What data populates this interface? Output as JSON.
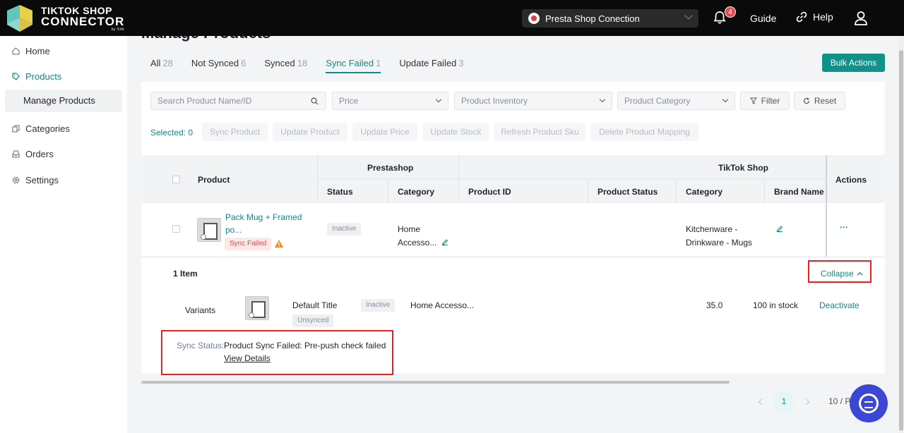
{
  "header": {
    "logo": {
      "line1": "TIKTOK SHOP",
      "line2": "CONNECTOR",
      "line3": "by Sitk"
    },
    "shop_select": "Presta Shop Conection",
    "notifications_count": "4",
    "guide": "Guide",
    "help": "Help"
  },
  "sidebar": {
    "items": [
      {
        "label": "Home",
        "icon": "home-icon"
      },
      {
        "label": "Products",
        "icon": "tag-icon"
      },
      {
        "label": "Manage Products"
      },
      {
        "label": "Categories",
        "icon": "copy-icon"
      },
      {
        "label": "Orders",
        "icon": "inbox-icon"
      },
      {
        "label": "Settings",
        "icon": "gear-icon"
      }
    ]
  },
  "page": {
    "title": "Manage Products"
  },
  "tabs": [
    {
      "label": "All",
      "count": "28"
    },
    {
      "label": "Not Synced",
      "count": "6"
    },
    {
      "label": "Synced",
      "count": "18"
    },
    {
      "label": "Sync Failed",
      "count": "1"
    },
    {
      "label": "Update Failed",
      "count": "3"
    }
  ],
  "bulk_actions": "Bulk Actions",
  "filters": {
    "search_placeholder": "Search Product Name/ID",
    "price": "Price",
    "inventory": "Product Inventory",
    "category": "Product Category",
    "filter": "Filter",
    "reset": "Reset"
  },
  "selection": {
    "selected": "Selected: 0",
    "actions": [
      "Sync Product",
      "Update Product",
      "Update Price",
      "Update Stock",
      "Refresh Product Sku",
      "Delete Product Mapping"
    ]
  },
  "table": {
    "group_prestashop": "Prestashop",
    "group_tiktok": "TikTok Shop",
    "col_product": "Product",
    "col_actions": "Actions",
    "cols": [
      "Status",
      "Category",
      "Product ID",
      "Product Status",
      "Category",
      "Brand Name"
    ],
    "row": {
      "name_line1": "Pack Mug + Framed",
      "name_line2": "po...",
      "sync_badge": "Sync Failed",
      "status": "Inactive",
      "category_line1": "Home",
      "category_line2": "Accesso...",
      "tiktok_category_line1": "Kitchenware -",
      "tiktok_category_line2": "Drinkware - Mugs",
      "more": "···"
    }
  },
  "expanded": {
    "items": "1 Item",
    "collapse": "Collapse",
    "variants_label": "Variants",
    "variant": {
      "title": "Default Title",
      "status": "Inactive",
      "sync": "Unsynced",
      "category": "Home Accesso...",
      "price": "35.0",
      "stock": "100 in stock",
      "action": "Deactivate"
    },
    "sync_status_label": "Sync Status:",
    "sync_status_text": "Product Sync Failed: Pre-push check failed",
    "view_details": "View Details"
  },
  "pagination": {
    "page": "1",
    "page_size": "10 / P"
  },
  "colors": {
    "accent": "#0f8a86",
    "button": "#10918a",
    "danger": "#e5484d",
    "highlight_box": "#e32222"
  }
}
